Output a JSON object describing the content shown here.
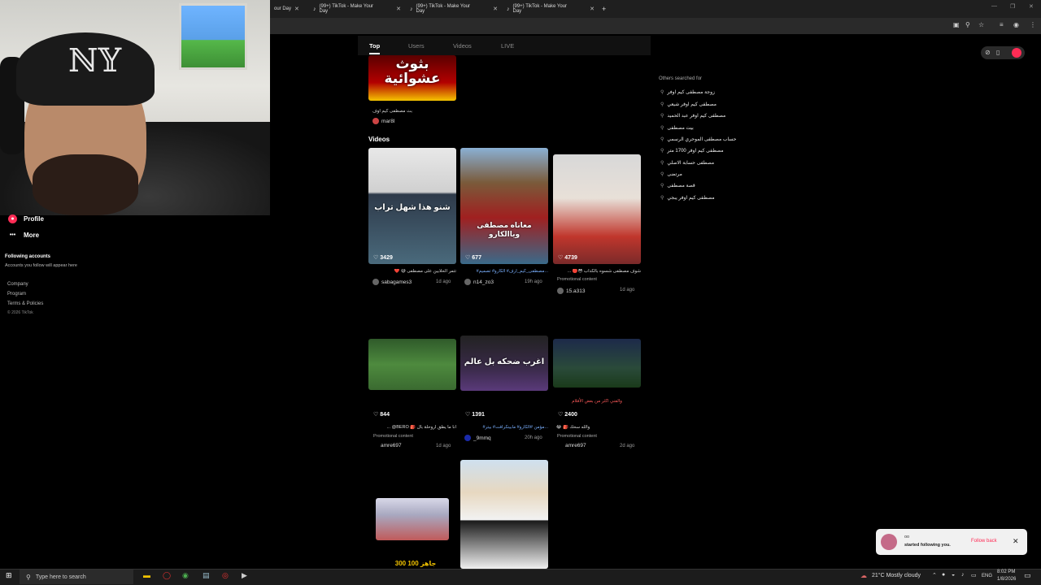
{
  "browser": {
    "tabs": [
      {
        "title": "our Day"
      },
      {
        "title": "(99+) TikTok - Make Your Day"
      },
      {
        "title": "(99+) TikTok - Make Your Day"
      },
      {
        "title": "(99+) TikTok - Make Your Day"
      }
    ],
    "new_tab": "+"
  },
  "left_nav": {
    "profile": "Profile",
    "more": "More",
    "following_title": "Following accounts",
    "following_hint": "Accounts you follow will appear here",
    "footer_company": "Company",
    "footer_program": "Program",
    "footer_terms": "Terms & Policies",
    "copyright": "© 2026 TikTok"
  },
  "search_tabs": [
    "Top",
    "Users",
    "Videos",
    "LIVE"
  ],
  "top_result": {
    "banner_text": "بثوث عشوائية",
    "caption": "بث مصطفى كيم اوف",
    "author": "mar8l"
  },
  "videos_heading": "Videos",
  "videos": [
    {
      "likes": "3429",
      "overlay": "شنو هذا شهل تراب",
      "caption": "❤️ 😅 تتمر الحلابين على مصطفى",
      "author": "sabagames3",
      "ago": "1d ago",
      "promo": ""
    },
    {
      "likes": "677",
      "overlay": "معاناه مصطفى وياالكارو",
      "caption": "#مصطفى_كيم_ارف# الكارو# تصميم...",
      "author": "n14_zo3",
      "ago": "19h ago",
      "promo": ""
    },
    {
      "likes": "4739",
      "overlay": "",
      "caption": "... 🔴😳 شوف مصطفى شسوه بالكداب",
      "author": "15.a313",
      "ago": "1d ago",
      "promo": "Promotional content"
    },
    {
      "likes": "844",
      "overlay": "",
      "caption": "... @BERO 🎒 انا ما يطق اروحلة بال",
      "author": "amre697",
      "ago": "1d ago",
      "promo": "Promotional content"
    },
    {
      "likes": "1391",
      "overlay": "اغرب ضحكه بل عالم",
      "caption": "#مؤمن #الكارو# مابينكرافت# بيتر...",
      "author": "_9mmq",
      "ago": "20h ago",
      "promo": ""
    },
    {
      "likes": "2400",
      "overlay": "والفني اكثر من بعض الأفلام",
      "caption": "😂 🎒 والله سحك",
      "author": "amre697",
      "ago": "2d ago",
      "promo": "Promotional content"
    },
    {
      "likes": "",
      "overlay": "جاهز 100 300",
      "caption": "",
      "author": "",
      "ago": "",
      "promo": ""
    },
    {
      "likes": "",
      "overlay": "",
      "caption": "",
      "author": "",
      "ago": "",
      "promo": ""
    }
  ],
  "others_searched": {
    "title": "Others searched for",
    "items": [
      "زوجة مصطفى كيم اوفر",
      "مصطفى كيم اوفر شيعي",
      "مصطفى كيم اوفر عبد الحميد",
      "بيت مصطفى",
      "حساب مصطفى الموحري الرسمي",
      "مصطفى كيم اوفر 1700 متر",
      "مصطفى حسابة الاصلي",
      "مرتضى",
      "قصة مصطفى",
      "مصطفى كيم اوفر يبجي"
    ]
  },
  "toast": {
    "user": "oo",
    "message": "started following you.",
    "action": "Follow back"
  },
  "taskbar": {
    "search_placeholder": "Type here to search",
    "weather": "21°C  Mostly cloudy",
    "lang": "ENG",
    "time": "8:02 PM",
    "date": "1/8/2026"
  },
  "colors": {
    "accent": "#fe2c55",
    "bg": "#000000"
  }
}
